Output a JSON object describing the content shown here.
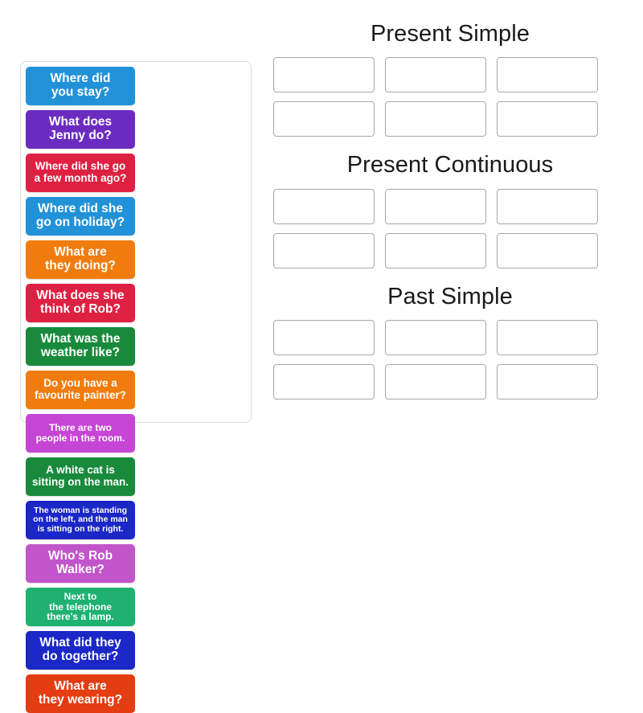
{
  "activity": {
    "type": "group-sort",
    "tray": {
      "name": "card-tray",
      "cards": [
        {
          "text": "Where did\nyou stay?",
          "color": "#2292d8",
          "size": "fs-lg"
        },
        {
          "text": "What does\nJenny do?",
          "color": "#6c2bc0",
          "size": "fs-lg"
        },
        {
          "text": "Where did she go\na few month ago?",
          "color": "#de2142",
          "size": "fs-md"
        },
        {
          "text": "Where did she\ngo on holiday?",
          "color": "#2292d8",
          "size": "fs-lg"
        },
        {
          "text": "What are\nthey doing?",
          "color": "#f07c0d",
          "size": "fs-lg"
        },
        {
          "text": "What does she\nthink of Rob?",
          "color": "#de2142",
          "size": "fs-lg"
        },
        {
          "text": "What was the\nweather like?",
          "color": "#198a3c",
          "size": "fs-lg"
        },
        {
          "text": "Do you have a\nfavourite painter?",
          "color": "#f07c0d",
          "size": "fs-md"
        },
        {
          "text": "There are two\npeople in the room.",
          "color": "#c645d5",
          "size": "fs-sm"
        },
        {
          "text": "A white cat is\nsitting on the man.",
          "color": "#198a3c",
          "size": "fs-md"
        },
        {
          "text": "The woman is standing\non the left, and the man\nis sitting on the right.",
          "color": "#1b27c6",
          "size": "fs-xs"
        },
        {
          "text": "Who's Rob\nWalker?",
          "color": "#c255c9",
          "size": "fs-lg"
        },
        {
          "text": "Next to\nthe telephone\nthere's a lamp.",
          "color": "#1fb172",
          "size": "fs-sm"
        },
        {
          "text": "What did they\ndo together?",
          "color": "#1b27c6",
          "size": "fs-lg"
        },
        {
          "text": "What are\nthey wearing?",
          "color": "#e33d11",
          "size": "fs-lg"
        }
      ]
    },
    "groups": [
      {
        "title": "Present Simple",
        "slots": [
          "",
          "",
          "",
          "",
          "",
          ""
        ]
      },
      {
        "title": "Present Continuous",
        "slots": [
          "",
          "",
          "",
          "",
          "",
          ""
        ]
      },
      {
        "title": "Past Simple",
        "slots": [
          "",
          "",
          "",
          "",
          "",
          ""
        ]
      }
    ]
  }
}
